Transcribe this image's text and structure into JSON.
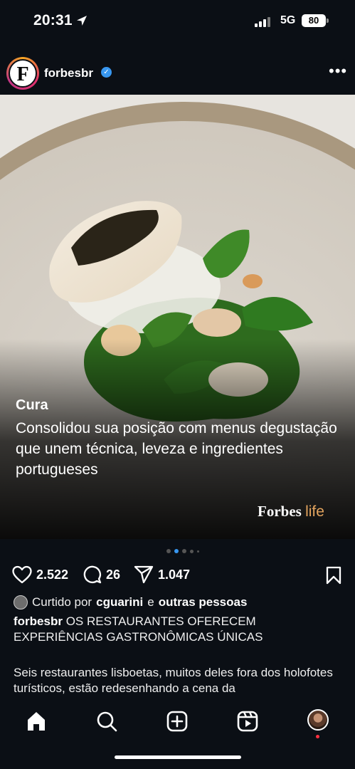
{
  "status": {
    "time": "20:31",
    "network": "5G",
    "battery": "80"
  },
  "post": {
    "username": "forbesbr",
    "avatar_letter": "F",
    "media": {
      "title": "Cura",
      "text": "Consolidou sua posição com menus degustação que unem técnica, leveza e ingredientes portugueses",
      "brand_main": "Forbes",
      "brand_sub": "life"
    },
    "carousel": {
      "count": 5,
      "active": 1
    },
    "likes": "2.522",
    "comments": "26",
    "shares": "1.047",
    "liked_by": {
      "prefix": "Curtido por",
      "user": "cguarini",
      "conj": "e",
      "others": "outras pessoas"
    },
    "caption_user": "forbesbr",
    "caption_text": "OS RESTAURANTES OFERECEM EXPERIÊNCIAS GASTRONÔMICAS ÚNICAS",
    "description": "Seis restaurantes lisboetas, muitos deles fora dos holofotes turísticos, estão redesenhando a cena da"
  },
  "icons": [
    "location-arrow-icon",
    "signal-icon",
    "battery-icon",
    "verified-icon",
    "more-icon",
    "heart-icon",
    "comment-icon",
    "share-icon",
    "bookmark-icon",
    "home-icon",
    "search-icon",
    "create-icon",
    "reels-icon",
    "profile-icon"
  ],
  "colors": {
    "background": "#0b0f15",
    "accent": "#3897f0",
    "brand_life": "#e3a45e",
    "notification": "#ff3040"
  }
}
